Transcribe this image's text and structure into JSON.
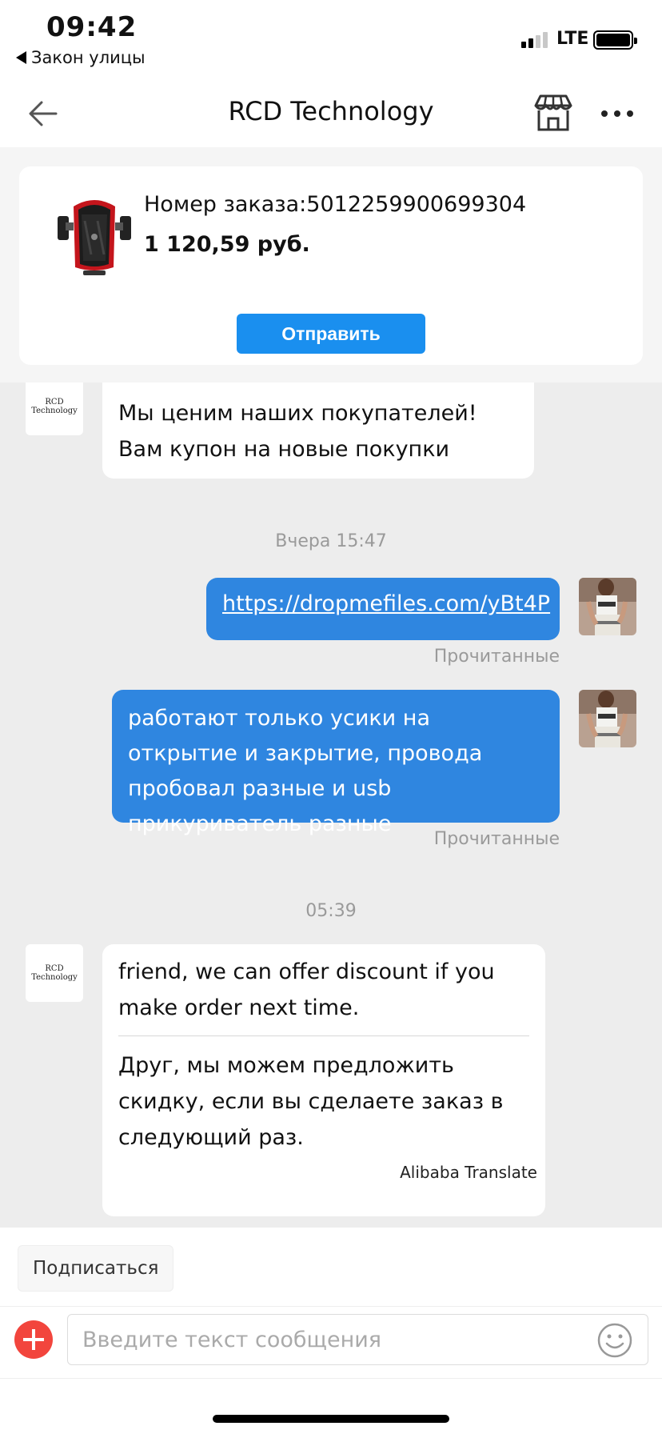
{
  "status_bar": {
    "time": "09:42",
    "back_app": "Закон улицы",
    "network": "LTE",
    "signal_bars": 2
  },
  "header": {
    "title": "RCD Technology",
    "icons": [
      "back-arrow-icon",
      "store-icon",
      "more-icon"
    ]
  },
  "order": {
    "number": "Номер заказа:5012259900699304",
    "price": "1 120,59 руб.",
    "send_button": "Отправить"
  },
  "chat": {
    "seller_name": "RCD Technology",
    "messages": [
      {
        "type": "in",
        "text": "Мы ценим наших покупателей! Вам купон на новые покупки"
      },
      {
        "type": "timestamp",
        "text": "Вчера 15:47"
      },
      {
        "type": "out",
        "text": "https://dropmefiles.com/yBt4P",
        "status": "Прочитанные"
      },
      {
        "type": "out",
        "text": "работают только усики на открытие и закрытие, провода пробовал разные и usb прикуриватель разные",
        "status": "Прочитанные"
      },
      {
        "type": "timestamp",
        "text": "05:39"
      },
      {
        "type": "in",
        "text": "friend, we can offer discount if you make order next time.",
        "translation": "Друг, мы можем предложить скидку, если вы сделаете заказ в следующий раз.",
        "translation_credit": "Alibaba Translate"
      }
    ]
  },
  "footer": {
    "subscribe": "Подписаться",
    "input_placeholder": "Введите текст сообщения"
  },
  "colors": {
    "accent": "#1a8fef",
    "outgoing_bubble": "#2f86e0",
    "add_button": "#f2453d",
    "chat_background": "#ededed"
  }
}
